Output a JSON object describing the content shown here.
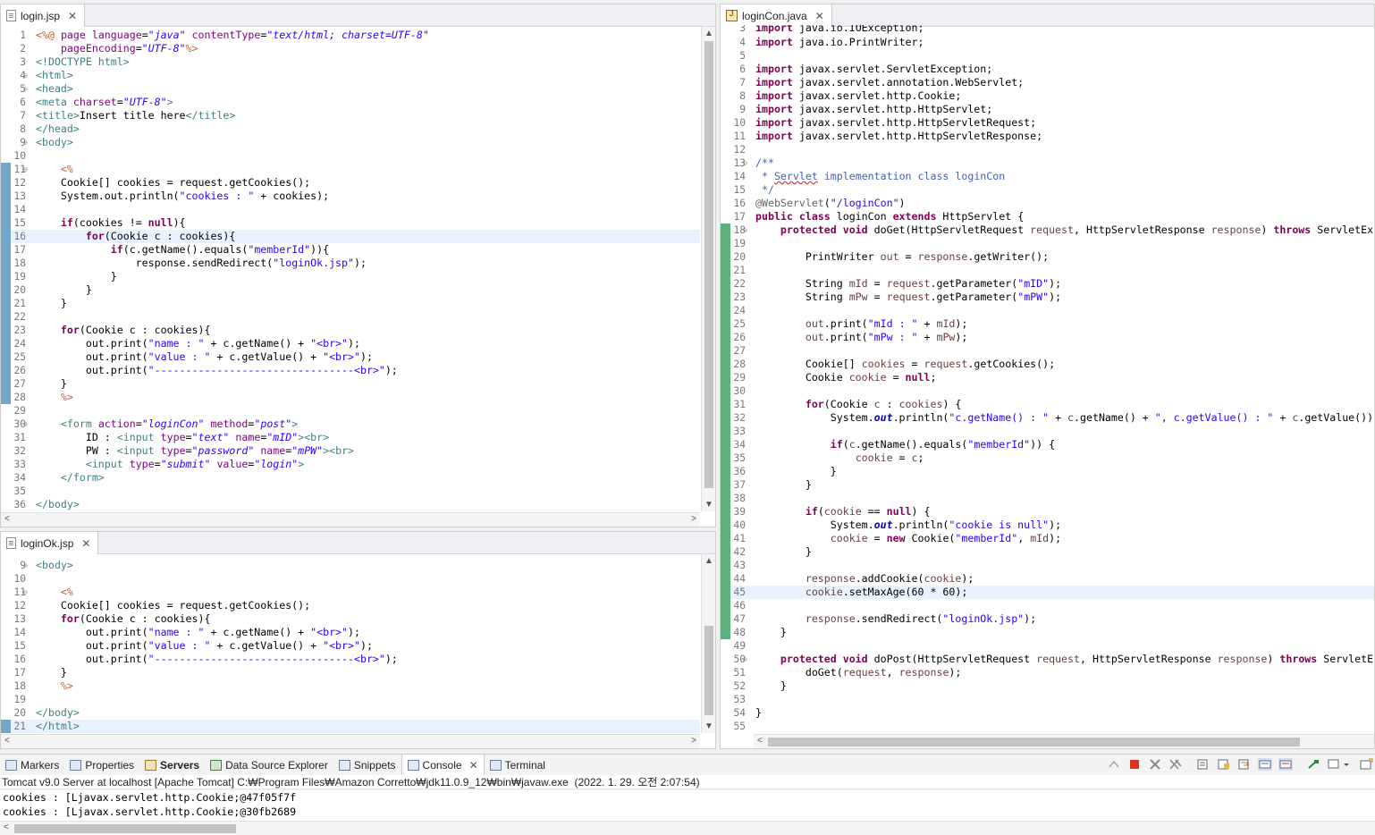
{
  "editors": {
    "login_jsp": {
      "tab": "login.jsp"
    },
    "loginok_jsp": {
      "tab": "loginOk.jsp"
    },
    "logincon_java": {
      "tab": "loginCon.java"
    }
  },
  "bottom_panel": {
    "tabs": [
      "Markers",
      "Properties",
      "Servers",
      "Data Source Explorer",
      "Snippets",
      "Console",
      "Terminal"
    ],
    "active_tab": "Console",
    "console_header": "Tomcat v9.0 Server at localhost [Apache Tomcat] C:₩Program Files₩Amazon Corretto₩jdk11.0.9_12₩bin₩javaw.exe  (2022. 1. 29. 오전 2:07:54)",
    "console_lines": [
      "cookies : [Ljavax.servlet.http.Cookie;@47f05f7f",
      "cookies : [Ljavax.servlet.http.Cookie;@30fb2689"
    ]
  },
  "icons": {
    "close": "close-icon",
    "file": "jsp-file-icon",
    "java": "java-file-icon"
  }
}
